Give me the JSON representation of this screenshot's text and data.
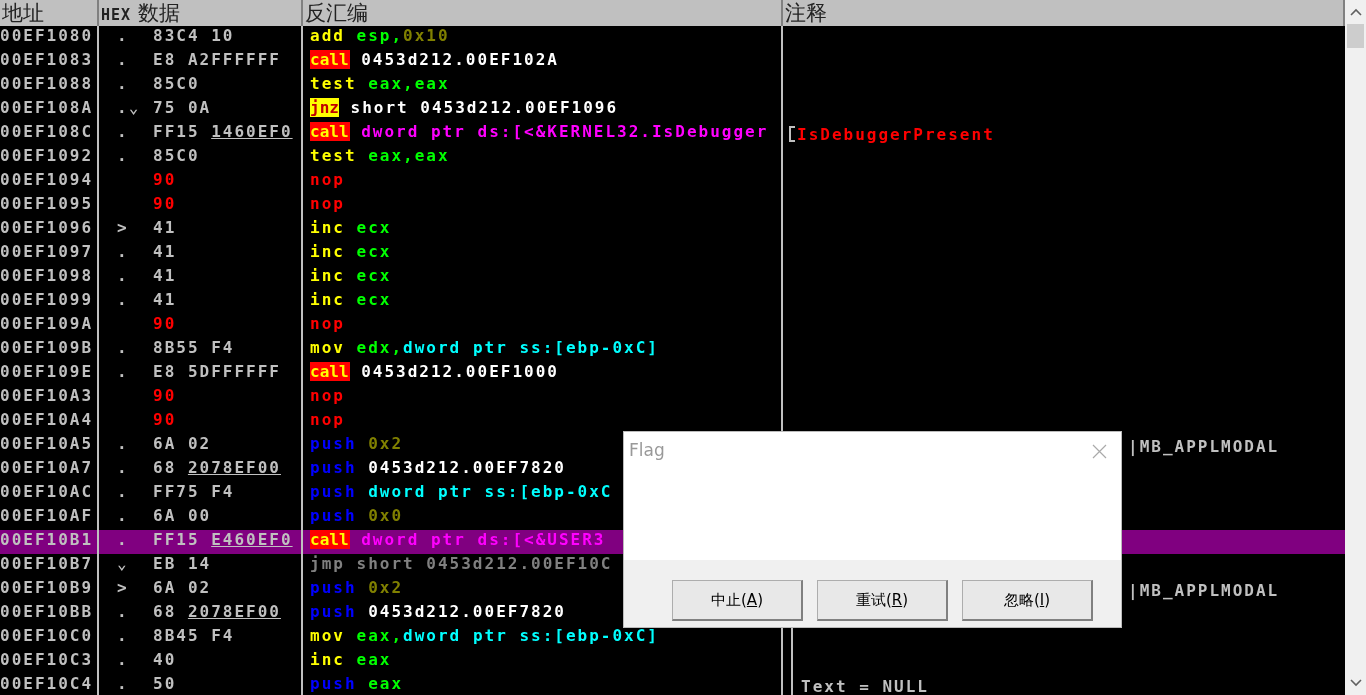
{
  "columns": [
    {
      "label": "地址"
    },
    {
      "label": "**HEX** 数据"
    },
    {
      "label": "反汇编"
    },
    {
      "label": "注释"
    }
  ],
  "rows": [
    {
      "address": "00EF1080",
      "marker": ".",
      "hex": [
        {
          "text": "83C4 10",
          "kind": "plain",
          "underlined": false
        }
      ],
      "disasm": [
        {
          "text": "add",
          "kind": "op"
        },
        {
          "text": " esp,",
          "kind": "reg"
        },
        {
          "text": "0x10",
          "kind": "imm"
        }
      ],
      "selected": false
    },
    {
      "address": "00EF1083",
      "marker": ".",
      "hex": [
        {
          "text": "E8 A2FFFFFF",
          "kind": "plain",
          "underlined": false
        }
      ],
      "disasm": [
        {
          "text": "call",
          "kind": "call"
        },
        {
          "text": " 0453d212.00EF102A",
          "kind": "addr"
        }
      ],
      "selected": false
    },
    {
      "address": "00EF1088",
      "marker": ".",
      "hex": [
        {
          "text": "85C0",
          "kind": "plain",
          "underlined": false
        }
      ],
      "disasm": [
        {
          "text": "test",
          "kind": "op"
        },
        {
          "text": " eax,eax",
          "kind": "reg"
        }
      ],
      "selected": false
    },
    {
      "address": "00EF108A",
      "marker": ".⌄",
      "hex": [
        {
          "text": "75 0A",
          "kind": "plain",
          "underlined": false
        }
      ],
      "disasm": [
        {
          "text": "jnz",
          "kind": "jcc"
        },
        {
          "text": " short 0453d212.00EF1096",
          "kind": "addr"
        }
      ],
      "selected": false
    },
    {
      "address": "00EF108C",
      "marker": ".",
      "hex": [
        {
          "text": "FF15 ",
          "kind": "plain",
          "underlined": false
        },
        {
          "text": "1460EF0",
          "kind": "plain",
          "underlined": true
        }
      ],
      "disasm": [
        {
          "text": "call",
          "kind": "call"
        },
        {
          "text": " dword ptr ds:[<&KERNEL32.IsDebugger",
          "kind": "api"
        }
      ],
      "comment": {
        "text": "IsDebuggerPresent",
        "kind": "api"
      },
      "kind": "bracket-open",
      "selected": false
    },
    {
      "address": "00EF1092",
      "marker": ".",
      "hex": [
        {
          "text": "85C0",
          "kind": "plain",
          "underlined": false
        }
      ],
      "disasm": [
        {
          "text": "test",
          "kind": "op"
        },
        {
          "text": " eax,eax",
          "kind": "reg"
        }
      ],
      "selected": false
    },
    {
      "address": "00EF1094",
      "marker": "",
      "hex": [
        {
          "text": "90",
          "kind": "nop",
          "underlined": false
        }
      ],
      "disasm": [
        {
          "text": "nop",
          "kind": "nop"
        }
      ],
      "selected": false
    },
    {
      "address": "00EF1095",
      "marker": "",
      "hex": [
        {
          "text": "90",
          "kind": "nop",
          "underlined": false
        }
      ],
      "disasm": [
        {
          "text": "nop",
          "kind": "nop"
        }
      ],
      "selected": false
    },
    {
      "address": "00EF1096",
      "marker": ">",
      "hex": [
        {
          "text": "41",
          "kind": "plain",
          "underlined": false
        }
      ],
      "disasm": [
        {
          "text": "inc",
          "kind": "op"
        },
        {
          "text": " ecx",
          "kind": "reg"
        }
      ],
      "selected": false
    },
    {
      "address": "00EF1097",
      "marker": ".",
      "hex": [
        {
          "text": "41",
          "kind": "plain",
          "underlined": false
        }
      ],
      "disasm": [
        {
          "text": "inc",
          "kind": "op"
        },
        {
          "text": " ecx",
          "kind": "reg"
        }
      ],
      "selected": false
    },
    {
      "address": "00EF1098",
      "marker": ".",
      "hex": [
        {
          "text": "41",
          "kind": "plain",
          "underlined": false
        }
      ],
      "disasm": [
        {
          "text": "inc",
          "kind": "op"
        },
        {
          "text": " ecx",
          "kind": "reg"
        }
      ],
      "selected": false
    },
    {
      "address": "00EF1099",
      "marker": ".",
      "hex": [
        {
          "text": "41",
          "kind": "plain",
          "underlined": false
        }
      ],
      "disasm": [
        {
          "text": "inc",
          "kind": "op"
        },
        {
          "text": " ecx",
          "kind": "reg"
        }
      ],
      "selected": false
    },
    {
      "address": "00EF109A",
      "marker": "",
      "hex": [
        {
          "text": "90",
          "kind": "nop",
          "underlined": false
        }
      ],
      "disasm": [
        {
          "text": "nop",
          "kind": "nop"
        }
      ],
      "selected": false
    },
    {
      "address": "00EF109B",
      "marker": ".",
      "hex": [
        {
          "text": "8B55 F4",
          "kind": "plain",
          "underlined": false
        }
      ],
      "disasm": [
        {
          "text": "mov",
          "kind": "op"
        },
        {
          "text": " edx,",
          "kind": "reg"
        },
        {
          "text": "dword ptr ss:[ebp-0xC]",
          "kind": "mem"
        }
      ],
      "selected": false
    },
    {
      "address": "00EF109E",
      "marker": ".",
      "hex": [
        {
          "text": "E8 5DFFFFFF",
          "kind": "plain",
          "underlined": false
        }
      ],
      "disasm": [
        {
          "text": "call",
          "kind": "call"
        },
        {
          "text": " 0453d212.00EF1000",
          "kind": "addr"
        }
      ],
      "selected": false
    },
    {
      "address": "00EF10A3",
      "marker": "",
      "hex": [
        {
          "text": "90",
          "kind": "nop",
          "underlined": false
        }
      ],
      "disasm": [
        {
          "text": "nop",
          "kind": "nop"
        }
      ],
      "selected": false
    },
    {
      "address": "00EF10A4",
      "marker": "",
      "hex": [
        {
          "text": "90",
          "kind": "nop",
          "underlined": false
        }
      ],
      "disasm": [
        {
          "text": "nop",
          "kind": "nop"
        }
      ],
      "selected": false
    },
    {
      "address": "00EF10A5",
      "marker": ".",
      "hex": [
        {
          "text": "6A 02",
          "kind": "plain",
          "underlined": false
        }
      ],
      "disasm": [
        {
          "text": "push",
          "kind": "push"
        },
        {
          "text": " 0x2",
          "kind": "imm"
        }
      ],
      "comment": {
        "text": "|MB_APPLMODAL",
        "kind": "plain",
        "covered": true
      },
      "selected": false
    },
    {
      "address": "00EF10A7",
      "marker": ".",
      "hex": [
        {
          "text": "68 ",
          "kind": "plain",
          "underlined": false
        },
        {
          "text": "2078EF00",
          "kind": "plain",
          "underlined": true
        }
      ],
      "disasm": [
        {
          "text": "push",
          "kind": "push"
        },
        {
          "text": " 0453d212.00EF7820",
          "kind": "addr"
        }
      ],
      "selected": false
    },
    {
      "address": "00EF10AC",
      "marker": ".",
      "hex": [
        {
          "text": "FF75 F4",
          "kind": "plain",
          "underlined": false
        }
      ],
      "disasm": [
        {
          "text": "push",
          "kind": "push"
        },
        {
          "text": " dword ptr ss:[ebp-0xC",
          "kind": "mem"
        }
      ],
      "selected": false
    },
    {
      "address": "00EF10AF",
      "marker": ".",
      "hex": [
        {
          "text": "6A 00",
          "kind": "plain",
          "underlined": false
        }
      ],
      "disasm": [
        {
          "text": "push",
          "kind": "push"
        },
        {
          "text": " 0x0",
          "kind": "imm"
        }
      ],
      "selected": false
    },
    {
      "address": "00EF10B1",
      "marker": ".",
      "hex": [
        {
          "text": "FF15 ",
          "kind": "plain",
          "underlined": false
        },
        {
          "text": "E460EF0",
          "kind": "plain",
          "underlined": true
        }
      ],
      "disasm": [
        {
          "text": "call",
          "kind": "call"
        },
        {
          "text": " dword ptr ds:[<&USER3",
          "kind": "api"
        }
      ],
      "selected": true
    },
    {
      "address": "00EF10B7",
      "marker": "⌄",
      "hex": [
        {
          "text": "EB 14",
          "kind": "plain",
          "underlined": false
        }
      ],
      "disasm": [
        {
          "text": "jmp short 0453d212.00EF10C",
          "kind": "jmp"
        }
      ],
      "selected": false
    },
    {
      "address": "00EF10B9",
      "marker": ">",
      "hex": [
        {
          "text": "6A 02",
          "kind": "plain",
          "underlined": false
        }
      ],
      "disasm": [
        {
          "text": "push",
          "kind": "push"
        },
        {
          "text": " 0x2",
          "kind": "imm"
        }
      ],
      "comment": {
        "text": "|MB_APPLMODAL",
        "kind": "plain",
        "covered": true
      },
      "selected": false
    },
    {
      "address": "00EF10BB",
      "marker": ".",
      "hex": [
        {
          "text": "68 ",
          "kind": "plain",
          "underlined": false
        },
        {
          "text": "2078EF00",
          "kind": "plain",
          "underlined": true
        }
      ],
      "disasm": [
        {
          "text": "push",
          "kind": "push"
        },
        {
          "text": " 0453d212.00EF7820",
          "kind": "addr"
        }
      ],
      "selected": false
    },
    {
      "address": "00EF10C0",
      "marker": ".",
      "hex": [
        {
          "text": "8B45 F4",
          "kind": "plain",
          "underlined": false
        }
      ],
      "disasm": [
        {
          "text": "mov",
          "kind": "op"
        },
        {
          "text": " eax,",
          "kind": "reg"
        },
        {
          "text": "dword ptr ss:[ebp-0xC]",
          "kind": "mem"
        }
      ],
      "kind": "bracket-line",
      "selected": false
    },
    {
      "address": "00EF10C3",
      "marker": ".",
      "hex": [
        {
          "text": "40",
          "kind": "plain",
          "underlined": false
        }
      ],
      "disasm": [
        {
          "text": "inc",
          "kind": "op"
        },
        {
          "text": " eax",
          "kind": "reg"
        }
      ],
      "kind": "bracket-line",
      "selected": false
    },
    {
      "address": "00EF10C4",
      "marker": ".",
      "hex": [
        {
          "text": "50",
          "kind": "plain",
          "underlined": false
        }
      ],
      "disasm": [
        {
          "text": "push",
          "kind": "push"
        },
        {
          "text": " eax",
          "kind": "reg"
        }
      ],
      "comment": {
        "text": "Text = NULL",
        "kind": "plain"
      },
      "kind": "bracket-line",
      "selected": false
    }
  ],
  "dialog": {
    "title": "Flag",
    "buttons": [
      {
        "parts": [
          "中止(",
          "A",
          ")"
        ]
      },
      {
        "parts": [
          "重试(",
          "R",
          ")"
        ]
      },
      {
        "parts": [
          "忽略(",
          "I",
          ")"
        ]
      }
    ]
  }
}
